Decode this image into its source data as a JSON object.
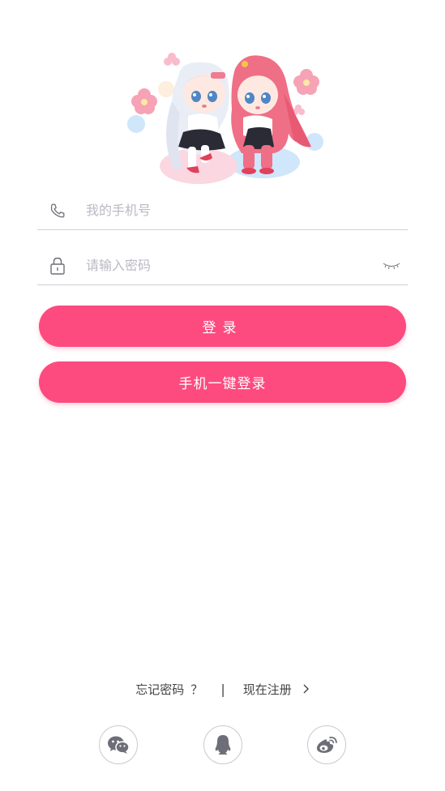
{
  "form": {
    "phone_placeholder": "我的手机号",
    "password_placeholder": "请输入密码"
  },
  "buttons": {
    "login_label": "登录",
    "quick_login_label": "手机一键登录"
  },
  "links": {
    "forgot_password": "忘记密码",
    "forgot_qmark": "？",
    "divider": "|",
    "register": "现在注册"
  },
  "icons": {
    "phone": "phone-icon",
    "lock": "lock-icon",
    "eye": "eye-closed-icon",
    "chevron": "chevron-right-icon",
    "wechat": "wechat-icon",
    "qq": "qq-icon",
    "weibo": "weibo-icon"
  },
  "colors": {
    "accent": "#fd4b7f",
    "icon_gray": "#6e6e78",
    "placeholder": "#b9bac3",
    "divider_line": "#cfcfd6"
  }
}
